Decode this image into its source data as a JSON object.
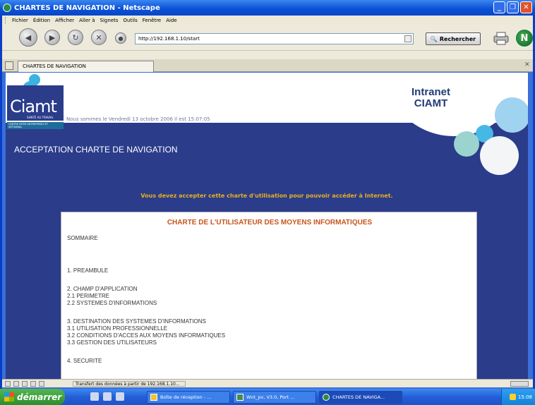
{
  "window": {
    "title": "CHARTES DE NAVIGATION - Netscape"
  },
  "menu": [
    "Fichier",
    "Édition",
    "Afficher",
    "Aller à",
    "Signets",
    "Outils",
    "Fenêtre",
    "Aide"
  ],
  "toolbar": {
    "url": "http://192.168.1.10/start",
    "search_label": "Rechercher"
  },
  "tab": {
    "title": "CHARTES DE NAVIGATION"
  },
  "header": {
    "logo_text": "Ciamt",
    "logo_sub": "SANTÉ AU TRAVAIL",
    "logo_strip": "CENTRE INTER-ENTREPRISES ET ARTISANAL",
    "date_text": "Nous sommes le Vendredi 13 octobre 2006 il est 15:07:05",
    "intranet_line1": "Intranet",
    "intranet_line2": "CIAMT"
  },
  "page": {
    "heading": "ACCEPTATION CHARTE DE NAVIGATION",
    "notice": "Vous devez accepter cette charte d'utilisation pour pouvoir accéder à Internet."
  },
  "document": {
    "title": "CHARTE DE L'UTILISATEUR DES MOYENS INFORMATIQUES",
    "lines": [
      "SOMMAIRE",
      "1. PREAMBULE",
      "2. CHAMP D'APPLICATION",
      "2.1 PERIMETRE",
      "2.2 SYSTEMES D'INFORMATIONS",
      "3. DESTINATION DES SYSTEMES D'INFORMATIONS",
      "3.1 UTILISATION PROFESSIONNELLE",
      "3.2 CONDITIONS D'ACCES AUX MOYENS INFORMATIQUES",
      "3.3 GESTION DES UTILISATEURS",
      "4. SECURITE"
    ]
  },
  "status": {
    "text": "Transfert des données à partir de 192.168.1.10..."
  },
  "taskbar": {
    "start_label": "démarrer",
    "tasks": [
      "Boîte de réception - ...",
      "Wnt_pv, V3.0, Port ...",
      "CHARTES DE NAVIGA..."
    ],
    "clock": "15:08"
  },
  "colors": {
    "page_bg": "#2a3c8a",
    "notice": "#e8b020",
    "doc_title": "#c7541c",
    "intranet": "#223a78"
  }
}
